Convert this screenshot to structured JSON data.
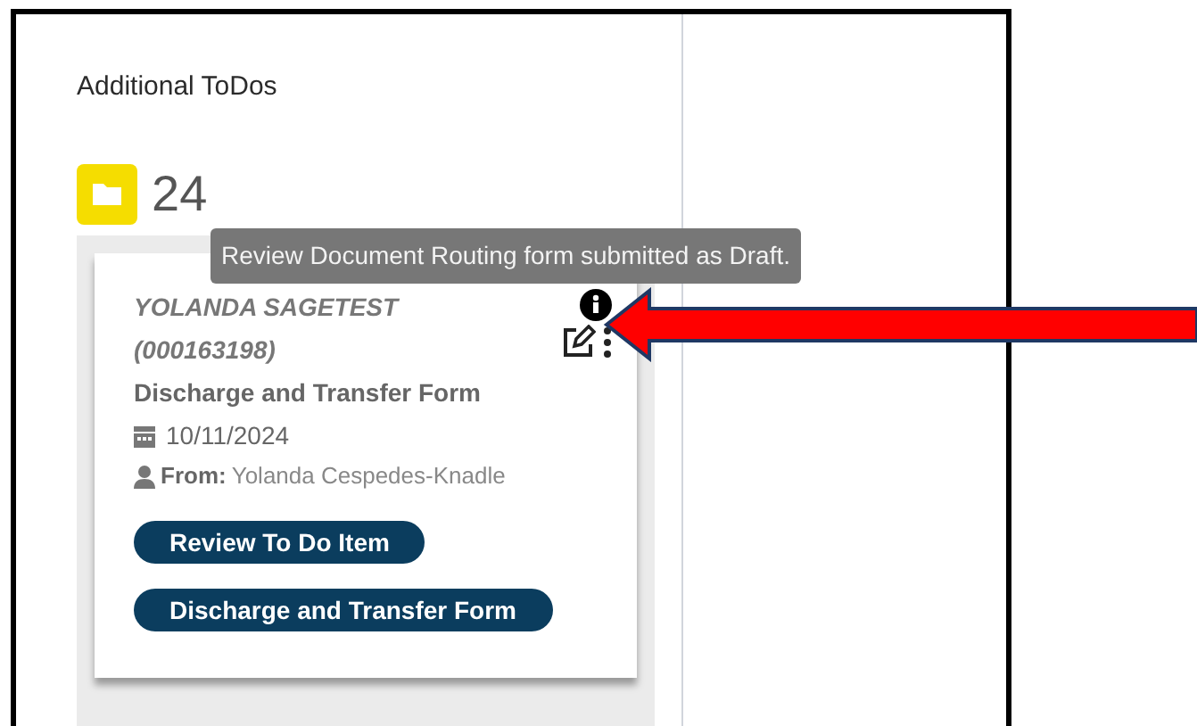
{
  "panel": {
    "title": "Additional ToDos",
    "count": "24"
  },
  "tooltip": "Review Document Routing form submitted as Draft.",
  "card": {
    "patient": "YOLANDA SAGETEST",
    "patient_id": "(000163198)",
    "form": "Discharge and Transfer Form",
    "date": "10/11/2024",
    "from_label": "From:",
    "from_name": "Yolanda Cespedes-Knadle",
    "buttons": [
      "Review To Do Item",
      "Discharge and Transfer Form"
    ]
  }
}
